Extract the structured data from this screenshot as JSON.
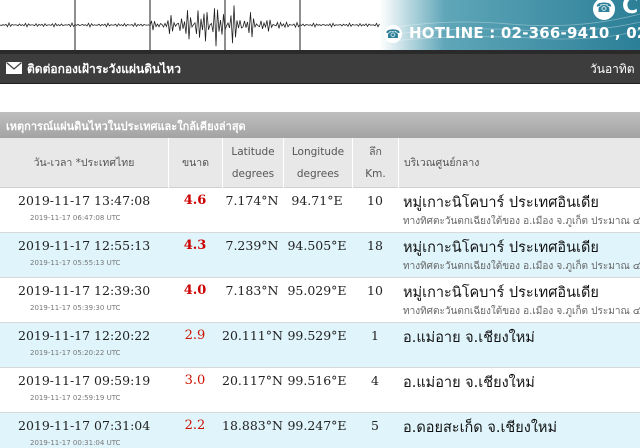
{
  "header": {
    "hotline_label": "HOTLINE : 02-366-9410 , 02-",
    "top_logo_letter": "C",
    "icons": {
      "phone": "phone-icon",
      "mail": "mail-icon"
    }
  },
  "contact_bar": {
    "label": "ติดต่อกองเฝ้าระวังแผ่นดินไหว",
    "date_label": "วันอาทิต"
  },
  "section": {
    "title": "เหตุการณ์แผ่นดินไหวในประเทศและใกล้เคียงล่าสุด"
  },
  "table": {
    "headers": {
      "datetime": "วัน-เวลา *ประเทศไทย",
      "magnitude": "ขนาด",
      "latitude_1": "Latitude",
      "latitude_2": "degrees",
      "longitude_1": "Longitude",
      "longitude_2": "degrees",
      "depth_1": "ลึก",
      "depth_2": "Km.",
      "region": "บริเวณศูนย์กลาง"
    },
    "rows": [
      {
        "datetime_th": "2019-11-17 13:47:08",
        "datetime_utc": "2019-11-17 06:47:08 UTC",
        "magnitude": "4.6",
        "latitude": "7.174°N",
        "longitude": "94.71°E",
        "depth": "10",
        "region": "หมู่เกาะนิโคบาร์ ประเทศอินเดีย",
        "region_sub": "ทางทิศตะวันตกเฉียงใต้ของ อ.เมือง จ.ภูเก็ต ประมาณ ๔"
      },
      {
        "datetime_th": "2019-11-17 12:55:13",
        "datetime_utc": "2019-11-17 05:55:13 UTC",
        "magnitude": "4.3",
        "latitude": "7.239°N",
        "longitude": "94.505°E",
        "depth": "18",
        "region": "หมู่เกาะนิโคบาร์ ประเทศอินเดีย",
        "region_sub": "ทางทิศตะวันตกเฉียงใต้ของ อ.เมือง จ.ภูเก็ต ประมาณ ๔"
      },
      {
        "datetime_th": "2019-11-17 12:39:30",
        "datetime_utc": "2019-11-17 05:39:30 UTC",
        "magnitude": "4.0",
        "latitude": "7.183°N",
        "longitude": "95.029°E",
        "depth": "10",
        "region": "หมู่เกาะนิโคบาร์ ประเทศอินเดีย",
        "region_sub": "ทางทิศตะวันตกเฉียงใต้ของ อ.เมือง จ.ภูเก็ต ประมาณ ๔"
      },
      {
        "datetime_th": "2019-11-17 12:20:22",
        "datetime_utc": "2019-11-17 05:20:22 UTC",
        "magnitude": "2.9",
        "latitude": "20.111°N",
        "longitude": "99.529°E",
        "depth": "1",
        "region": "อ.แม่อาย จ.เชียงใหม่",
        "region_sub": ""
      },
      {
        "datetime_th": "2019-11-17 09:59:19",
        "datetime_utc": "2019-11-17 02:59:19 UTC",
        "magnitude": "3.0",
        "latitude": "20.117°N",
        "longitude": "99.516°E",
        "depth": "4",
        "region": "อ.แม่อาย จ.เชียงใหม่",
        "region_sub": ""
      },
      {
        "datetime_th": "2019-11-17 07:31:04",
        "datetime_utc": "2019-11-17 00:31:04 UTC",
        "magnitude": "2.2",
        "latitude": "18.883°N",
        "longitude": "99.247°E",
        "depth": "5",
        "region": "อ.ดอยสะเก็ด จ.เชียงใหม่",
        "region_sub": ""
      }
    ]
  },
  "colors": {
    "accent": "#2b7f97",
    "magnitude_red": "#cc0000",
    "row_alt": "#dff4fb",
    "header_dark": "#3d3d3d"
  }
}
